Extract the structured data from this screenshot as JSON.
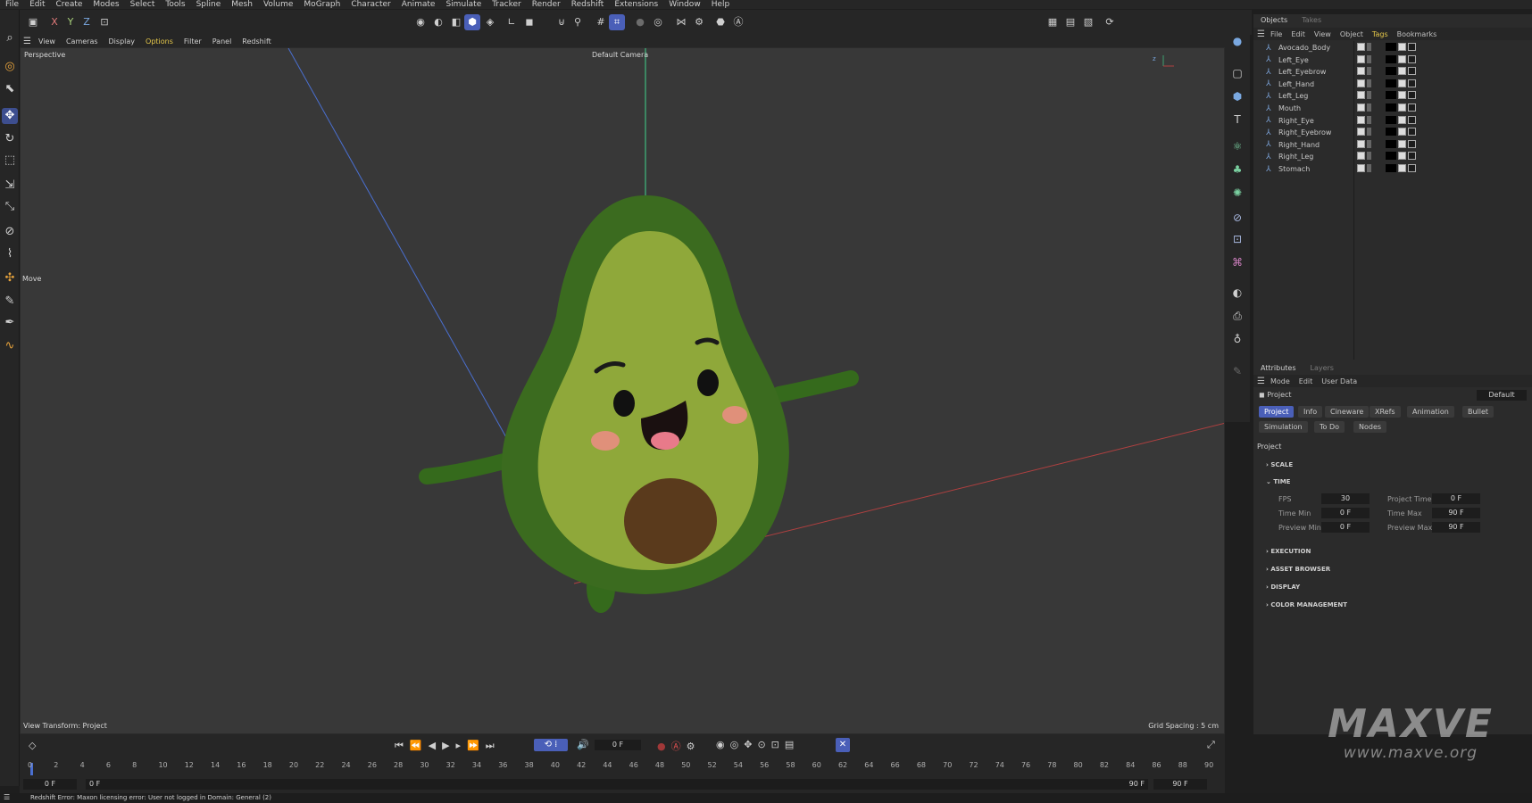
{
  "menu": [
    "File",
    "Edit",
    "Create",
    "Modes",
    "Select",
    "Tools",
    "Spline",
    "Mesh",
    "Volume",
    "MoGraph",
    "Character",
    "Animate",
    "Simulate",
    "Tracker",
    "Render",
    "Redshift",
    "Extensions",
    "Window",
    "Help"
  ],
  "viewport_menu": [
    "View",
    "Cameras",
    "Display",
    "Options",
    "Filter",
    "Panel",
    "Redshift"
  ],
  "viewport": {
    "projection": "Perspective",
    "camera": "Default Camera",
    "move_label": "Move",
    "view_transform": "View Transform: Project",
    "grid_spacing": "Grid Spacing : 5 cm"
  },
  "objects_panel": {
    "tabs": [
      "Objects",
      "Takes"
    ],
    "menu": [
      "File",
      "Edit",
      "View",
      "Object",
      "Tags",
      "Bookmarks"
    ],
    "items": [
      "Avocado_Body",
      "Left_Eye",
      "Left_Eyebrow",
      "Left_Hand",
      "Left_Leg",
      "Mouth",
      "Right_Eye",
      "Right_Eyebrow",
      "Right_Hand",
      "Right_Leg",
      "Stomach"
    ]
  },
  "attributes_panel": {
    "tabs": [
      "Attributes",
      "Layers"
    ],
    "menu": [
      "Mode",
      "Edit",
      "User Data"
    ],
    "object_name": "Project",
    "preset": "Default",
    "subtabs": [
      "Project",
      "Info",
      "Cineware",
      "XRefs",
      "Animation",
      "Bullet",
      "Simulation",
      "To Do",
      "Nodes"
    ],
    "heading": "Project",
    "sections": [
      "SCALE",
      "TIME",
      "EXECUTION",
      "ASSET BROWSER",
      "DISPLAY",
      "COLOR MANAGEMENT"
    ],
    "fields": {
      "fps_label": "FPS",
      "fps": "30",
      "project_time_label": "Project Time",
      "project_time": "0 F",
      "time_min_label": "Time Min",
      "time_min": "0 F",
      "time_max_label": "Time Max",
      "time_max": "90 F",
      "preview_min_label": "Preview Min",
      "preview_min": "0 F",
      "preview_max_label": "Preview Max",
      "preview_max": "90 F"
    }
  },
  "timeline": {
    "current_frame": "0 F",
    "ticks": [
      "0",
      "2",
      "4",
      "6",
      "8",
      "10",
      "12",
      "14",
      "16",
      "18",
      "20",
      "22",
      "24",
      "26",
      "28",
      "30",
      "32",
      "34",
      "36",
      "38",
      "40",
      "42",
      "44",
      "46",
      "48",
      "50",
      "52",
      "54",
      "56",
      "58",
      "60",
      "62",
      "64",
      "66",
      "68",
      "70",
      "72",
      "74",
      "76",
      "78",
      "80",
      "82",
      "84",
      "86",
      "88",
      "90"
    ],
    "start": "0 F",
    "start2": "0 F",
    "end": "90 F",
    "end2": "90 F"
  },
  "status": "Redshift Error: Maxon licensing error: User not logged in Domain: General (2)",
  "watermark": {
    "logo": "MAXVE",
    "url": "www.maxve.org"
  },
  "colors": {
    "accent": "#4a5fb8",
    "avocado_skin": "#3b6b1f",
    "avocado_flesh": "#8fa83a",
    "pit": "#5a3a1c"
  }
}
